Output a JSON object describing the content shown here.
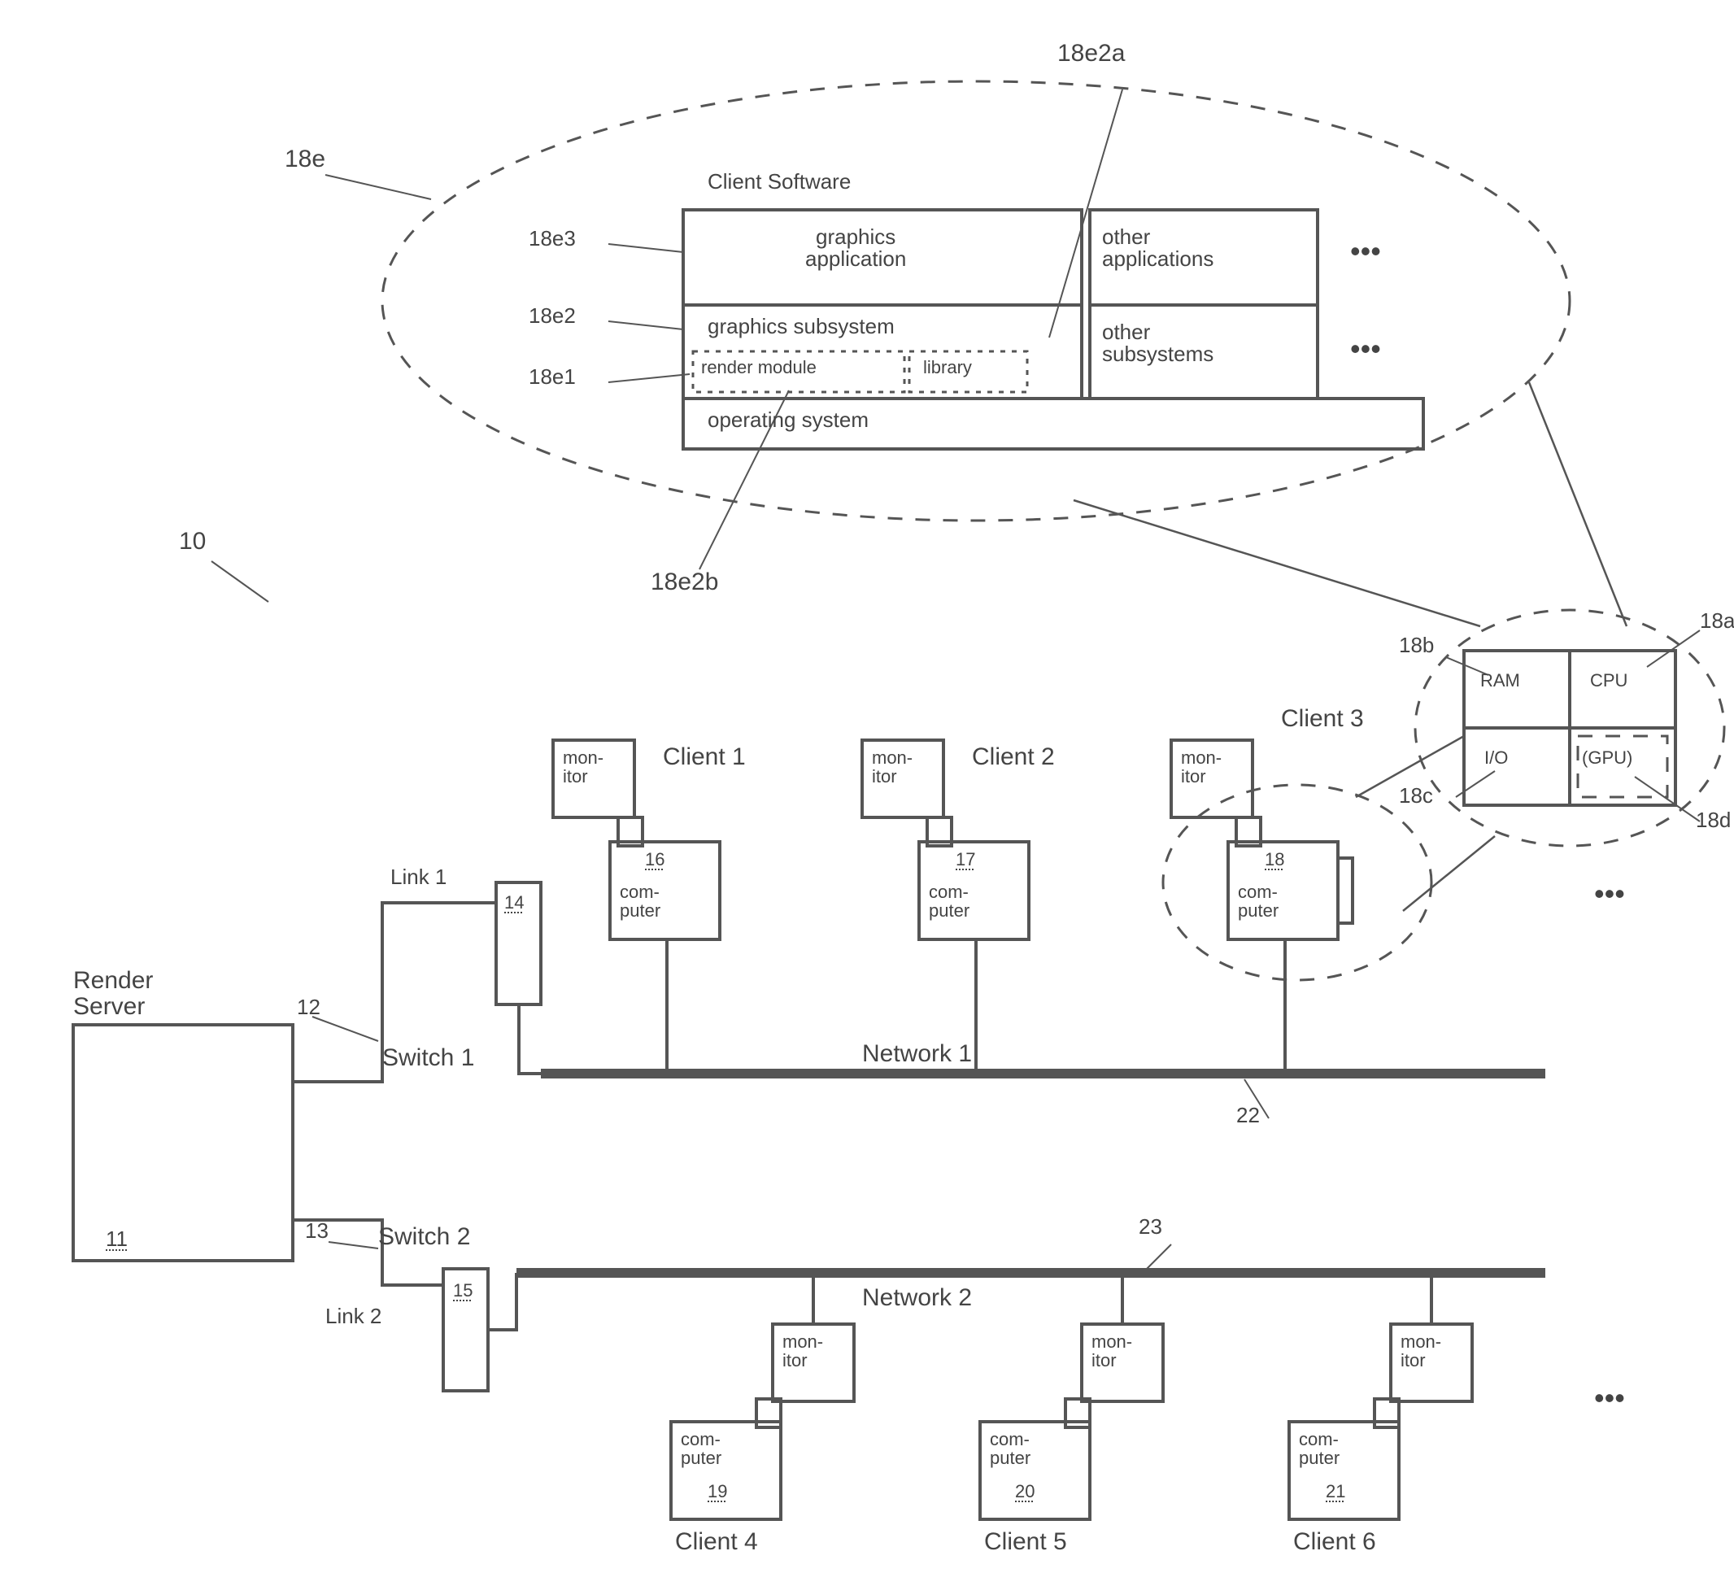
{
  "refs": {
    "r10": "10",
    "r11": "11",
    "r12": "12",
    "r13": "13",
    "r14": "14",
    "r15": "15",
    "r16": "16",
    "r17": "17",
    "r18": "18",
    "r19": "19",
    "r20": "20",
    "r21": "21",
    "r22": "22",
    "r23": "23",
    "r18a": "18a",
    "r18b": "18b",
    "r18c": "18c",
    "r18d": "18d",
    "r18e": "18e",
    "r18e1": "18e1",
    "r18e2": "18e2",
    "r18e3": "18e3",
    "r18e2a": "18e2a",
    "r18e2b": "18e2b"
  },
  "labels": {
    "render_server": "Render\nServer",
    "link1": "Link 1",
    "link2": "Link 2",
    "switch1": "Switch 1",
    "switch2": "Switch 2",
    "network1": "Network 1",
    "network2": "Network 2",
    "client1": "Client 1",
    "client2": "Client 2",
    "client3": "Client 3",
    "client4": "Client 4",
    "client5": "Client 5",
    "client6": "Client 6",
    "monitor": "mon-\nitor",
    "computer": "com-\nputer",
    "ellipsis": "•••"
  },
  "client_hw": {
    "ram": "RAM",
    "cpu": "CPU",
    "io": "I/O",
    "gpu": "(GPU)"
  },
  "software": {
    "title": "Client Software",
    "graphics_app": "graphics\napplication",
    "other_apps": "other\napplications",
    "graphics_subsystem": "graphics subsystem",
    "render_module": "render module",
    "library": "library",
    "other_subsystems": "other\nsubsystems",
    "os": "operating system"
  }
}
